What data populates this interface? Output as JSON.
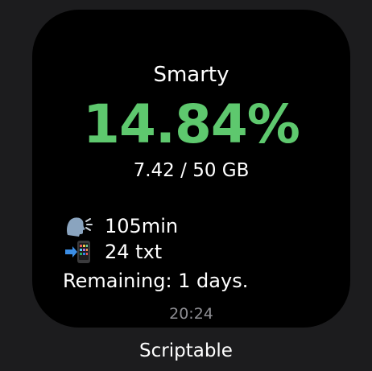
{
  "widget": {
    "carrier": "Smarty",
    "percent": "14.84%",
    "usage": "7.42 / 50 GB",
    "minutes": "105min",
    "texts": "24 txt",
    "remaining": "Remaining: 1 days.",
    "time": "20:24",
    "minutes_icon": "speaking-head-icon",
    "texts_icon": "phone-arrow-icon",
    "accent_color": "#5ec86e"
  },
  "app": {
    "label": "Scriptable"
  }
}
